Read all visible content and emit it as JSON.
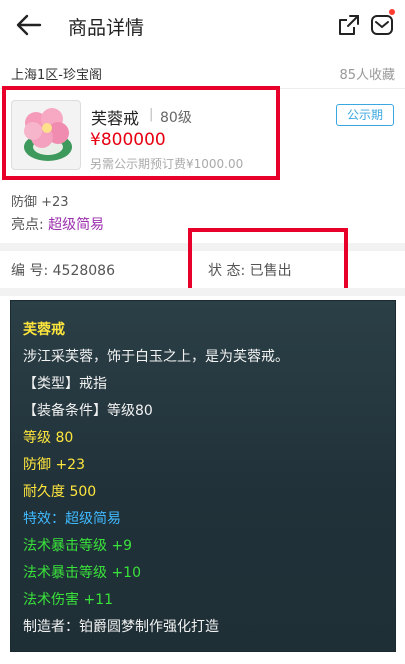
{
  "header": {
    "title": "商品详情"
  },
  "seller": {
    "server": "上海1区-珍宝阁",
    "favorites": "85人收藏"
  },
  "item": {
    "name": "芙蓉戒",
    "level": "80级",
    "price": "¥800000",
    "fee": "另需公示期预订费¥1000.00",
    "badge": "公示期"
  },
  "attrs": {
    "defense": "防御 +23",
    "highlight_label": "亮点:",
    "highlight_value": "超级简易"
  },
  "meta": {
    "id_label": "编  号:",
    "id_value": "4528086",
    "status_label": "状  态:",
    "status_value": "已售出"
  },
  "detail": {
    "lines": [
      "芙蓉戒",
      "涉江采芙蓉，饰于白玉之上，是为芙蓉戒。",
      "【类型】戒指",
      "【装备条件】等级80",
      "等级 80",
      "防御 +23",
      "耐久度 500",
      "特效：超级简易",
      "法术暴击等级 +9",
      "法术暴击等级 +10",
      "法术伤害 +11",
      "制造者：铂爵圆梦制作强化打造"
    ]
  },
  "colors": {
    "price": "#e60012",
    "highlight": "#9b2fae",
    "badge": "#3ba7e0",
    "annotation": "#e8002a"
  }
}
